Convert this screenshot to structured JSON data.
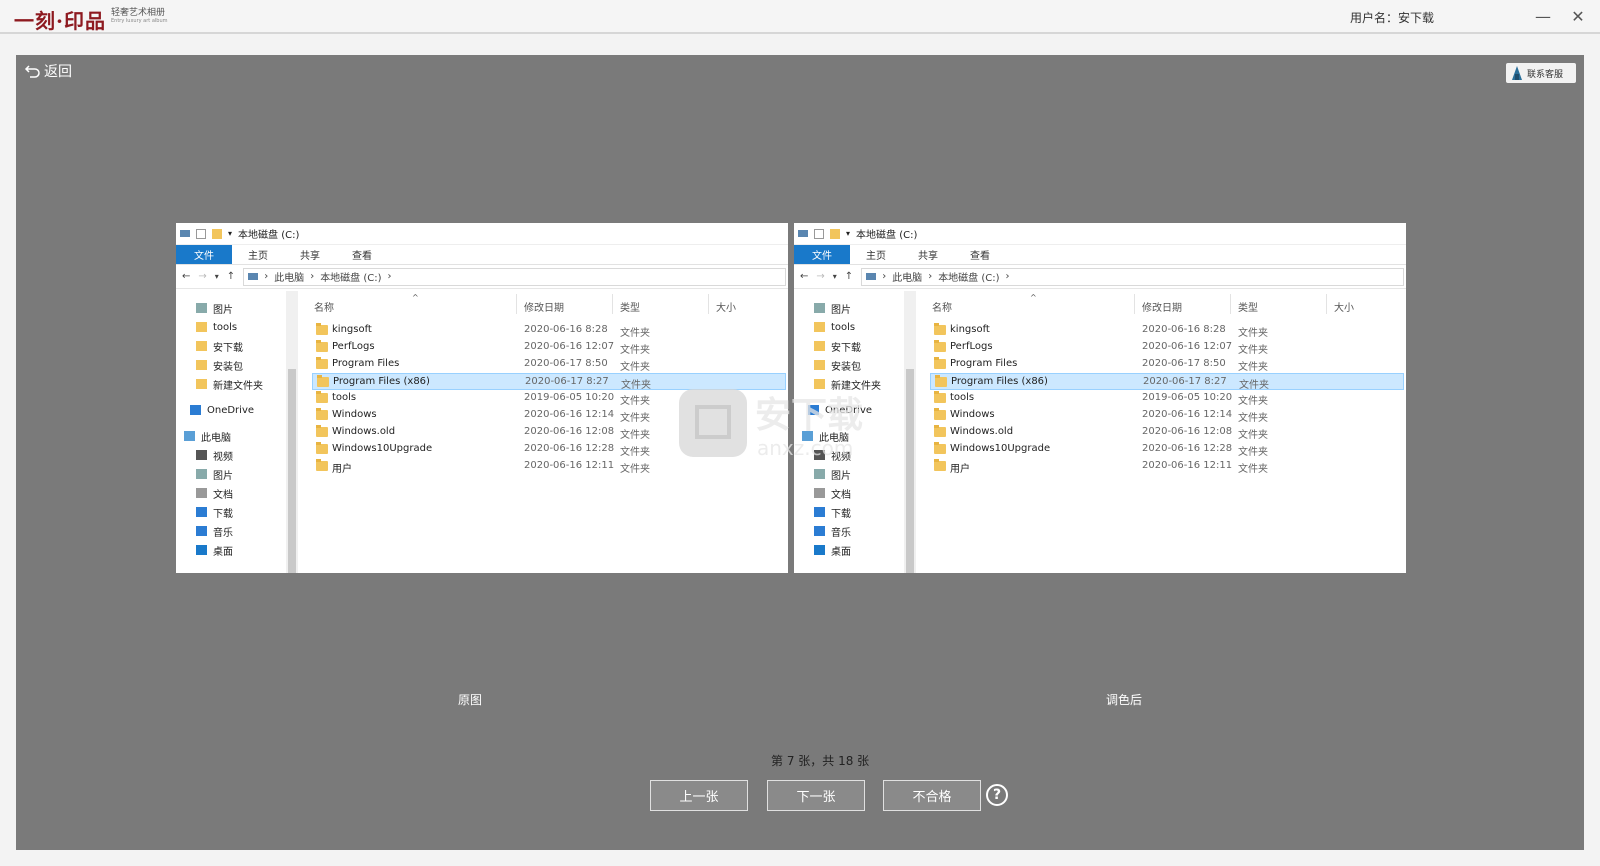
{
  "app": {
    "logo": "一刻·印品",
    "logo_sub": "轻奢艺术相册",
    "logo_sub_en": "Entry luxury art album",
    "username": "用户名：安下载"
  },
  "toolbar": {
    "back_label": "返回",
    "service_label": "联系客服"
  },
  "explorer": {
    "title": "本地磁盘 (C:)",
    "tabs": [
      "文件",
      "主页",
      "共享",
      "查看"
    ],
    "breadcrumb": [
      "此电脑",
      "本地磁盘 (C:)"
    ],
    "columns": [
      "名称",
      "修改日期",
      "类型",
      "大小"
    ],
    "nav_items": [
      "图片",
      "tools",
      "安下载",
      "安装包",
      "新建文件夹",
      "OneDrive",
      "此电脑",
      "视频",
      "图片",
      "文档",
      "下载",
      "音乐",
      "桌面"
    ],
    "files": [
      {
        "name": "kingsoft",
        "date": "2020-06-16 8:28",
        "type": "文件夹"
      },
      {
        "name": "PerfLogs",
        "date": "2020-06-16 12:07",
        "type": "文件夹"
      },
      {
        "name": "Program Files",
        "date": "2020-06-17 8:50",
        "type": "文件夹"
      },
      {
        "name": "Program Files (x86)",
        "date": "2020-06-17 8:27",
        "type": "文件夹"
      },
      {
        "name": "tools",
        "date": "2019-06-05 10:20",
        "type": "文件夹"
      },
      {
        "name": "Windows",
        "date": "2020-06-16 12:14",
        "type": "文件夹"
      },
      {
        "name": "Windows.old",
        "date": "2020-06-16 12:08",
        "type": "文件夹"
      },
      {
        "name": "Windows10Upgrade",
        "date": "2020-06-16 12:28",
        "type": "文件夹"
      },
      {
        "name": "用户",
        "date": "2020-06-16 12:11",
        "type": "文件夹"
      }
    ],
    "selected_index": 3
  },
  "captions": {
    "original": "原图",
    "adjusted": "调色后"
  },
  "pager": {
    "counter": "第 7 张，共 18 张",
    "prev_label": "上一张",
    "next_label": "下一张",
    "reject_label": "不合格",
    "help_label": "?"
  },
  "watermark": {
    "text": "安下载",
    "sub": "anxz.com"
  },
  "colors": {
    "brand": "#8e1a20",
    "panel": "#7a7a7a",
    "file_tab": "#1979ca",
    "selection": "#cce8ff"
  }
}
